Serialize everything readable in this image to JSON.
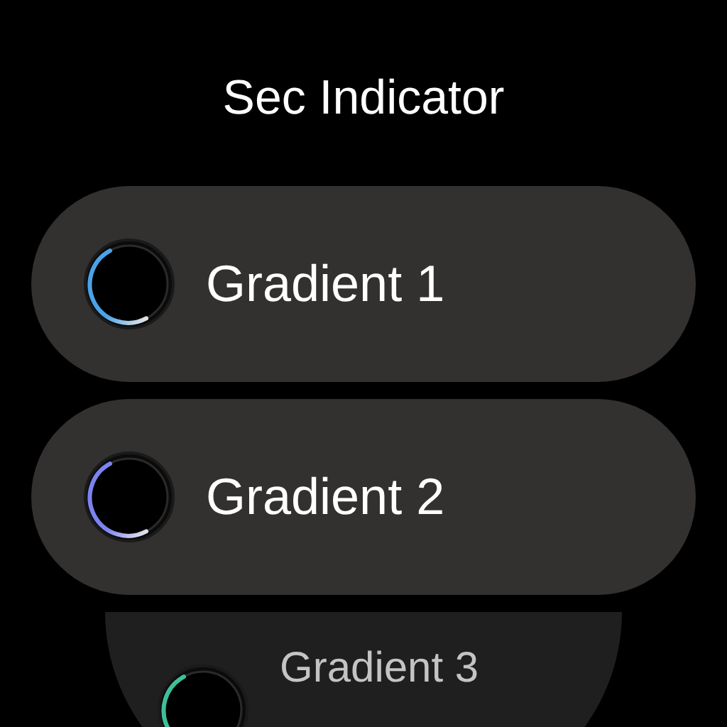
{
  "title": "Sec Indicator",
  "options": [
    {
      "label": "Gradient 1",
      "color": "#4aa3e8"
    },
    {
      "label": "Gradient 2",
      "color": "#7c83f0"
    },
    {
      "label": "Gradient 3",
      "color": "#3fbf9a"
    }
  ]
}
